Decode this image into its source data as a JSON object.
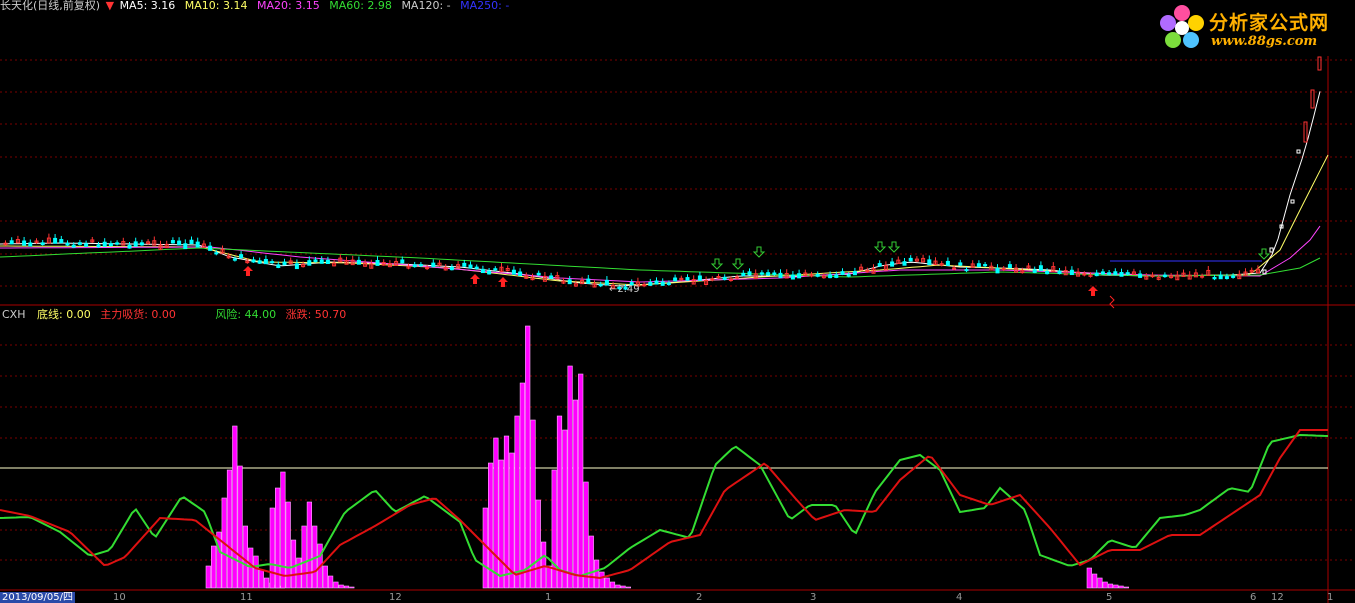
{
  "header": {
    "title": "长天化(日线,前复权)",
    "ma_items": [
      {
        "label": "MA5: 3.16",
        "color": "#ffffff"
      },
      {
        "label": "MA10: 3.14",
        "color": "#ffff66"
      },
      {
        "label": "MA20: 3.15",
        "color": "#ff44ff"
      },
      {
        "label": "MA60: 2.98",
        "color": "#33dd33"
      },
      {
        "label": "MA120: -",
        "color": "#cccccc"
      },
      {
        "label": "MA250: -",
        "color": "#3333ff"
      }
    ]
  },
  "indicator": {
    "name": "CXH",
    "items": [
      {
        "label": "底线: 0.00",
        "color": "#ffff66"
      },
      {
        "label": "主力吸货: 0.00",
        "color": "#ff3333"
      },
      {
        "label": "风险: 44.00",
        "color": "#33dd33"
      },
      {
        "label": "涨跌: 50.70",
        "color": "#ff3333"
      }
    ]
  },
  "price_panel": {
    "low_label": "2.49"
  },
  "x_axis": {
    "date_label": "2013/09/05/四",
    "ticks": [
      "10",
      "11",
      "12",
      "1",
      "2",
      "3",
      "4",
      "5",
      "6",
      "12",
      "1"
    ]
  },
  "logo": {
    "name": "分析家公式网",
    "url": "www.88gs.com"
  },
  "colors": {
    "grid": "#7a0000",
    "up": "#ff3333",
    "down": "#00ffff",
    "volume": "#ff00ff",
    "risk": "#33dd33",
    "change": "#dd1111",
    "buy_arrow": "#ff2222",
    "sell_arrow": "#33cc33"
  }
}
